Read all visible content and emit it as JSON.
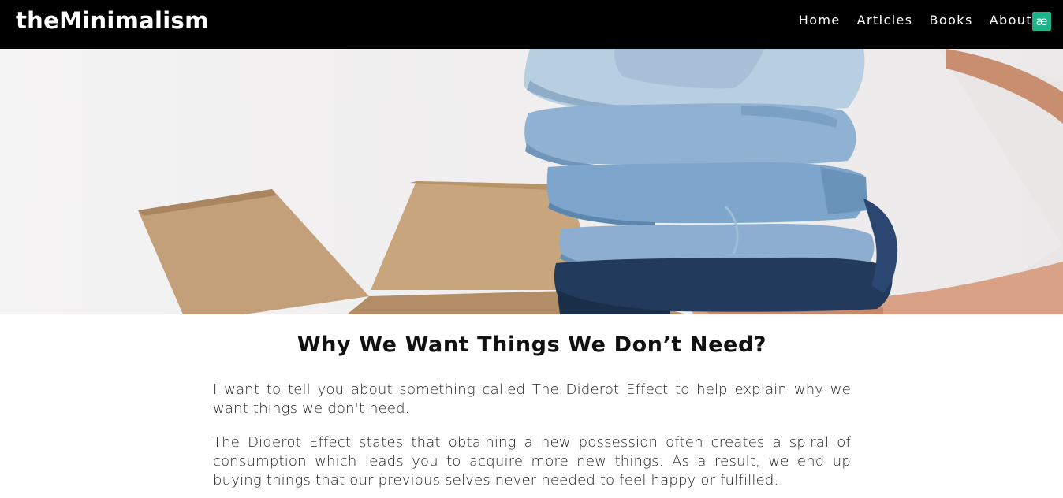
{
  "brand": "theMinimalism",
  "nav": {
    "items": [
      {
        "label": "Home"
      },
      {
        "label": "Articles"
      },
      {
        "label": "Books"
      },
      {
        "label": "About"
      }
    ]
  },
  "extension_badge": {
    "glyph": "æ",
    "color": "#1fb389",
    "icon": "extension-icon"
  },
  "hero": {
    "icon": "folded-jeans-box-photo"
  },
  "article": {
    "title": "Why We Want Things We Don’t Need?",
    "paragraphs": [
      "I want to tell you about something called The Diderot Effect to help explain why we want things we don't need.",
      "The Diderot Effect states that obtaining a new possession often creates a spiral of consumption which leads you to acquire more new things. As a result, we end up buying things that our previous selves never needed to feel happy or fulfilled."
    ]
  },
  "colors": {
    "navbar_bg": "#000000",
    "text": "#222222"
  }
}
